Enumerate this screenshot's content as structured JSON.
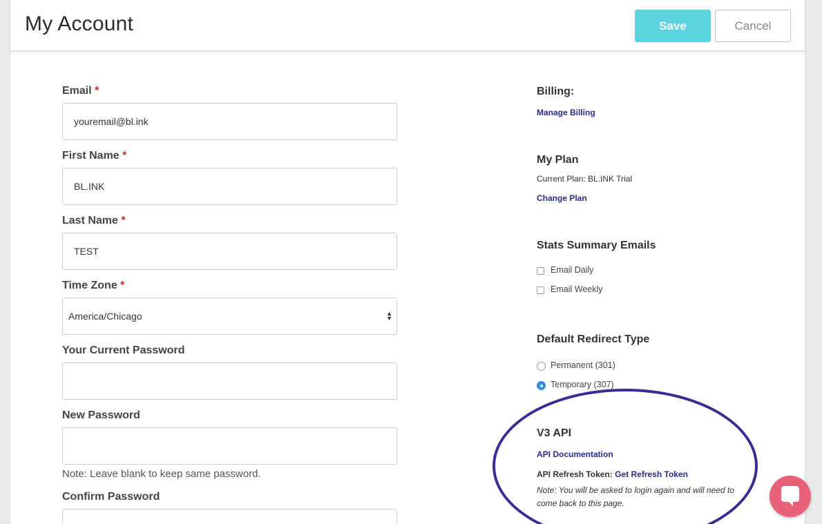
{
  "header": {
    "title": "My Account",
    "save_label": "Save",
    "cancel_label": "Cancel"
  },
  "form": {
    "required_mark": "*",
    "email": {
      "label": "Email",
      "value": "youremail@bl.ink"
    },
    "first_name": {
      "label": "First Name",
      "value": "BL.INK"
    },
    "last_name": {
      "label": "Last Name",
      "value": "TEST"
    },
    "time_zone": {
      "label": "Time Zone",
      "value": "America/Chicago"
    },
    "current_password": {
      "label": "Your Current Password",
      "value": ""
    },
    "new_password": {
      "label": "New Password",
      "value": "",
      "note": "Note: Leave blank to keep same password."
    },
    "confirm_password": {
      "label": "Confirm Password",
      "value": ""
    }
  },
  "billing": {
    "title": "Billing:",
    "manage_link": "Manage Billing"
  },
  "plan": {
    "title": "My Plan",
    "current": "Current Plan: BL.INK Trial",
    "change_link": "Change Plan"
  },
  "stats": {
    "title": "Stats Summary Emails",
    "options": [
      {
        "label": "Email Daily",
        "checked": false
      },
      {
        "label": "Email Weekly",
        "checked": false
      }
    ]
  },
  "redirect": {
    "title": "Default Redirect Type",
    "options": [
      {
        "label": "Permanent (301)",
        "selected": false
      },
      {
        "label": "Temporary (307)",
        "selected": true
      }
    ]
  },
  "api": {
    "title": "V3 API",
    "doc_link": "API Documentation",
    "token_label": "API Refresh Token:",
    "token_link": "Get Refresh Token",
    "note": "Note: You will be asked to login again and will need to come back to this page."
  },
  "colors": {
    "accent": "#5cd4e0",
    "link": "#2b2a8a",
    "required": "#d9232d",
    "highlight_ellipse": "#3d2b93",
    "chat_button": "#e8627a"
  },
  "icons": {
    "chat": "chat-bubble-icon",
    "select": "select-arrows-icon"
  }
}
